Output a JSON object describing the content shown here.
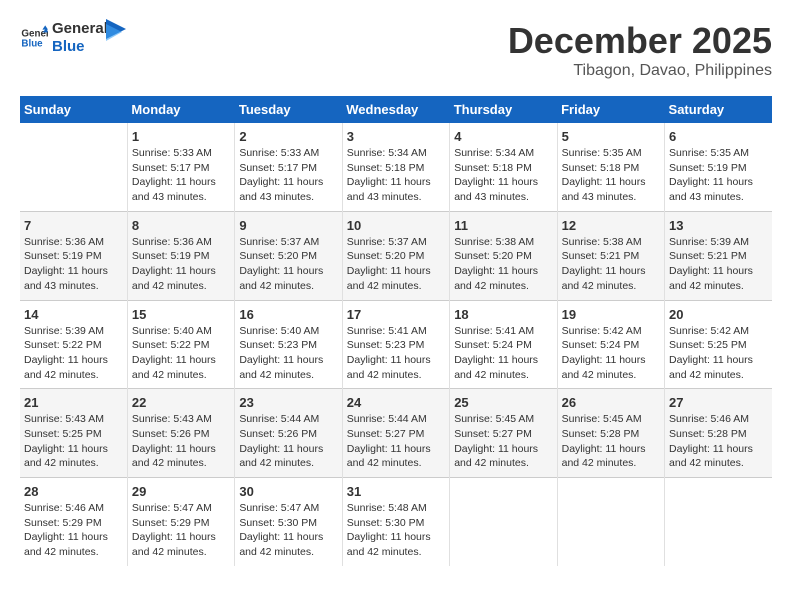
{
  "logo": {
    "line1": "General",
    "line2": "Blue"
  },
  "title": "December 2025",
  "location": "Tibagon, Davao, Philippines",
  "days_of_week": [
    "Sunday",
    "Monday",
    "Tuesday",
    "Wednesday",
    "Thursday",
    "Friday",
    "Saturday"
  ],
  "weeks": [
    [
      {
        "day": "",
        "empty": true
      },
      {
        "day": "1",
        "sunrise": "5:33 AM",
        "sunset": "5:17 PM",
        "daylight": "11 hours and 43 minutes."
      },
      {
        "day": "2",
        "sunrise": "5:33 AM",
        "sunset": "5:17 PM",
        "daylight": "11 hours and 43 minutes."
      },
      {
        "day": "3",
        "sunrise": "5:34 AM",
        "sunset": "5:18 PM",
        "daylight": "11 hours and 43 minutes."
      },
      {
        "day": "4",
        "sunrise": "5:34 AM",
        "sunset": "5:18 PM",
        "daylight": "11 hours and 43 minutes."
      },
      {
        "day": "5",
        "sunrise": "5:35 AM",
        "sunset": "5:18 PM",
        "daylight": "11 hours and 43 minutes."
      },
      {
        "day": "6",
        "sunrise": "5:35 AM",
        "sunset": "5:19 PM",
        "daylight": "11 hours and 43 minutes."
      }
    ],
    [
      {
        "day": "7",
        "sunrise": "5:36 AM",
        "sunset": "5:19 PM",
        "daylight": "11 hours and 43 minutes."
      },
      {
        "day": "8",
        "sunrise": "5:36 AM",
        "sunset": "5:19 PM",
        "daylight": "11 hours and 42 minutes."
      },
      {
        "day": "9",
        "sunrise": "5:37 AM",
        "sunset": "5:20 PM",
        "daylight": "11 hours and 42 minutes."
      },
      {
        "day": "10",
        "sunrise": "5:37 AM",
        "sunset": "5:20 PM",
        "daylight": "11 hours and 42 minutes."
      },
      {
        "day": "11",
        "sunrise": "5:38 AM",
        "sunset": "5:20 PM",
        "daylight": "11 hours and 42 minutes."
      },
      {
        "day": "12",
        "sunrise": "5:38 AM",
        "sunset": "5:21 PM",
        "daylight": "11 hours and 42 minutes."
      },
      {
        "day": "13",
        "sunrise": "5:39 AM",
        "sunset": "5:21 PM",
        "daylight": "11 hours and 42 minutes."
      }
    ],
    [
      {
        "day": "14",
        "sunrise": "5:39 AM",
        "sunset": "5:22 PM",
        "daylight": "11 hours and 42 minutes."
      },
      {
        "day": "15",
        "sunrise": "5:40 AM",
        "sunset": "5:22 PM",
        "daylight": "11 hours and 42 minutes."
      },
      {
        "day": "16",
        "sunrise": "5:40 AM",
        "sunset": "5:23 PM",
        "daylight": "11 hours and 42 minutes."
      },
      {
        "day": "17",
        "sunrise": "5:41 AM",
        "sunset": "5:23 PM",
        "daylight": "11 hours and 42 minutes."
      },
      {
        "day": "18",
        "sunrise": "5:41 AM",
        "sunset": "5:24 PM",
        "daylight": "11 hours and 42 minutes."
      },
      {
        "day": "19",
        "sunrise": "5:42 AM",
        "sunset": "5:24 PM",
        "daylight": "11 hours and 42 minutes."
      },
      {
        "day": "20",
        "sunrise": "5:42 AM",
        "sunset": "5:25 PM",
        "daylight": "11 hours and 42 minutes."
      }
    ],
    [
      {
        "day": "21",
        "sunrise": "5:43 AM",
        "sunset": "5:25 PM",
        "daylight": "11 hours and 42 minutes."
      },
      {
        "day": "22",
        "sunrise": "5:43 AM",
        "sunset": "5:26 PM",
        "daylight": "11 hours and 42 minutes."
      },
      {
        "day": "23",
        "sunrise": "5:44 AM",
        "sunset": "5:26 PM",
        "daylight": "11 hours and 42 minutes."
      },
      {
        "day": "24",
        "sunrise": "5:44 AM",
        "sunset": "5:27 PM",
        "daylight": "11 hours and 42 minutes."
      },
      {
        "day": "25",
        "sunrise": "5:45 AM",
        "sunset": "5:27 PM",
        "daylight": "11 hours and 42 minutes."
      },
      {
        "day": "26",
        "sunrise": "5:45 AM",
        "sunset": "5:28 PM",
        "daylight": "11 hours and 42 minutes."
      },
      {
        "day": "27",
        "sunrise": "5:46 AM",
        "sunset": "5:28 PM",
        "daylight": "11 hours and 42 minutes."
      }
    ],
    [
      {
        "day": "28",
        "sunrise": "5:46 AM",
        "sunset": "5:29 PM",
        "daylight": "11 hours and 42 minutes."
      },
      {
        "day": "29",
        "sunrise": "5:47 AM",
        "sunset": "5:29 PM",
        "daylight": "11 hours and 42 minutes."
      },
      {
        "day": "30",
        "sunrise": "5:47 AM",
        "sunset": "5:30 PM",
        "daylight": "11 hours and 42 minutes."
      },
      {
        "day": "31",
        "sunrise": "5:48 AM",
        "sunset": "5:30 PM",
        "daylight": "11 hours and 42 minutes."
      },
      {
        "day": "",
        "empty": true
      },
      {
        "day": "",
        "empty": true
      },
      {
        "day": "",
        "empty": true
      }
    ]
  ],
  "labels": {
    "sunrise_prefix": "Sunrise: ",
    "sunset_prefix": "Sunset: ",
    "daylight_prefix": "Daylight: "
  }
}
